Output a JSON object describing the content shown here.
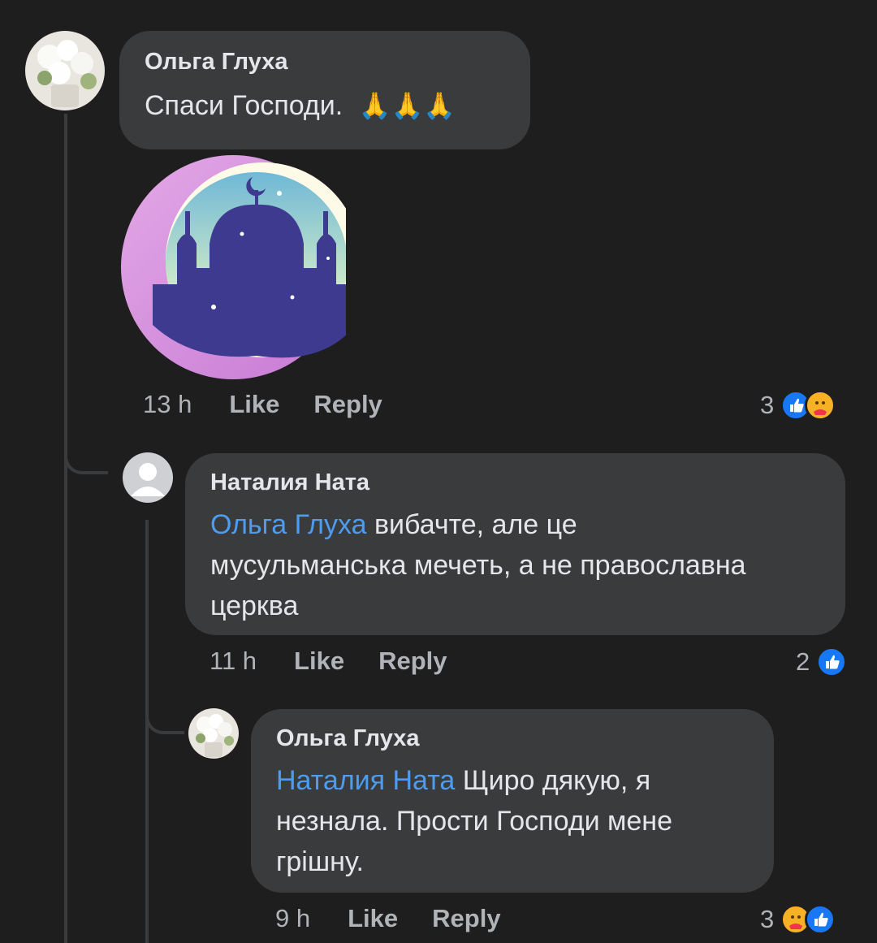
{
  "comments": [
    {
      "author": "Ольга Глуха",
      "text": "Спаси Господи.",
      "emoji": "🙏🙏🙏",
      "time": "13 h",
      "like_label": "Like",
      "reply_label": "Reply",
      "reaction_count": "3",
      "reactions": [
        "like-icon",
        "care-icon"
      ],
      "sticker": "mosque-crescent-sticker"
    },
    {
      "author": "Наталия Ната",
      "mention": "Ольга Глуха",
      "text_line1": " вибачте, але це",
      "text_line2": "мусульманська мечеть, а не православна",
      "text_line3": "церква",
      "time": "11 h",
      "like_label": "Like",
      "reply_label": "Reply",
      "reaction_count": "2",
      "reactions": [
        "like-icon"
      ]
    },
    {
      "author": "Ольга Глуха",
      "mention": "Наталия Ната",
      "text_line1": " Щиро дякую,  я",
      "text_line2": "незнала.  Прости Господи  мене",
      "text_line3": "грішну.",
      "time": "9 h",
      "like_label": "Like",
      "reply_label": "Reply",
      "reaction_count": "3",
      "reactions": [
        "care-icon",
        "like-icon"
      ]
    }
  ],
  "colors": {
    "background": "#1e1e1f",
    "bubble": "#3a3b3c",
    "mention": "#4d9cf0",
    "meta_text": "#b0b3b8",
    "like_blue": "#1877f2",
    "care_yellow": "#f7b125"
  }
}
